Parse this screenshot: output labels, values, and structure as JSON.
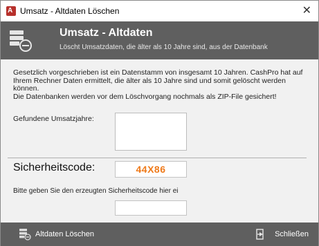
{
  "window": {
    "title": "Umsatz - Altdaten Löschen",
    "close_glyph": "✕"
  },
  "header": {
    "title": "Umsatz - Altdaten",
    "subtitle": "Löscht Umsatzdaten, die älter als 10 Jahre sind, aus der Datenbank"
  },
  "content": {
    "description": "Gesetzlich vorgeschrieben ist ein Datenstamm von insgesamt 10 Jahren. CashPro hat auf Ihrem Rechner Daten ermittelt, die älter als 10 Jahre sind und somit gelöscht werden können.\nDie Datenbanken werden vor dem Löschvorgang nochmals als ZIP-File gesichert!",
    "found_years_label": "Gefundene Umsatzjahre:",
    "security_label": "Sicherheitscode:",
    "security_code": "44X86",
    "hint": "Bitte geben Sie den erzeugten Sicherheitscode hier ei",
    "code_input_value": ""
  },
  "footer": {
    "delete_label": "Altdaten Löschen",
    "close_label": "Schließen"
  },
  "colors": {
    "header_bg": "#5f5f5f",
    "content_bg": "#f1f1f1",
    "code_accent": "#ef7a1a",
    "app_icon": "#b7312c"
  },
  "icons": {
    "app": "access-app-icon",
    "header": "database-delete-icon",
    "delete_button": "database-delete-icon",
    "close_button": "exit-door-icon"
  }
}
